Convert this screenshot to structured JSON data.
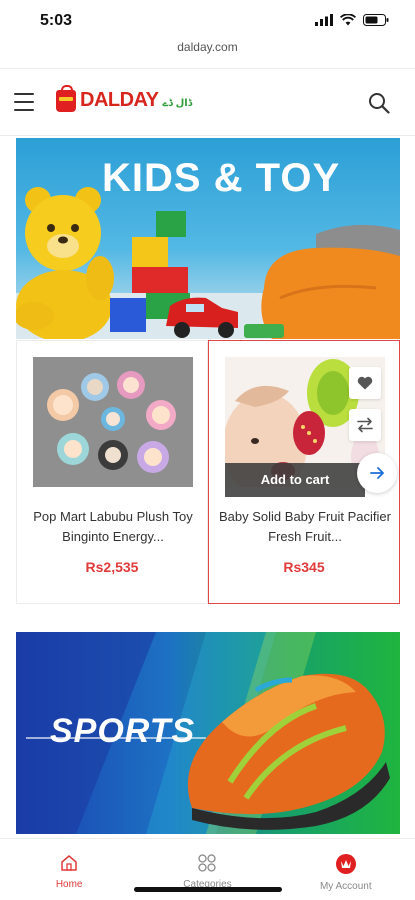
{
  "status_bar": {
    "time": "5:03"
  },
  "browser": {
    "url": "dalday.com"
  },
  "header": {
    "logo_text": "DALDAY",
    "logo_subtext": "ڈال ڈے"
  },
  "banners": [
    {
      "title": "KIDS & TOY"
    },
    {
      "title": "SPORTS"
    }
  ],
  "products": [
    {
      "name": "Pop Mart Labubu Plush Toy Binginto Energy...",
      "price": "Rs2,535"
    },
    {
      "name": "Baby Solid Baby Fruit Pacifier Fresh Fruit...",
      "price": "Rs345",
      "add_to_cart_label": "Add to cart"
    }
  ],
  "bottom_nav": [
    {
      "label": "Home",
      "icon": "home-icon",
      "active": true
    },
    {
      "label": "Categories",
      "icon": "categories-icon",
      "active": false
    },
    {
      "label": "My Account",
      "icon": "account-icon",
      "active": false
    }
  ],
  "colors": {
    "brand_red": "#d8261f",
    "price_red": "#e03a3a",
    "active_nav": "#e03a3a"
  }
}
